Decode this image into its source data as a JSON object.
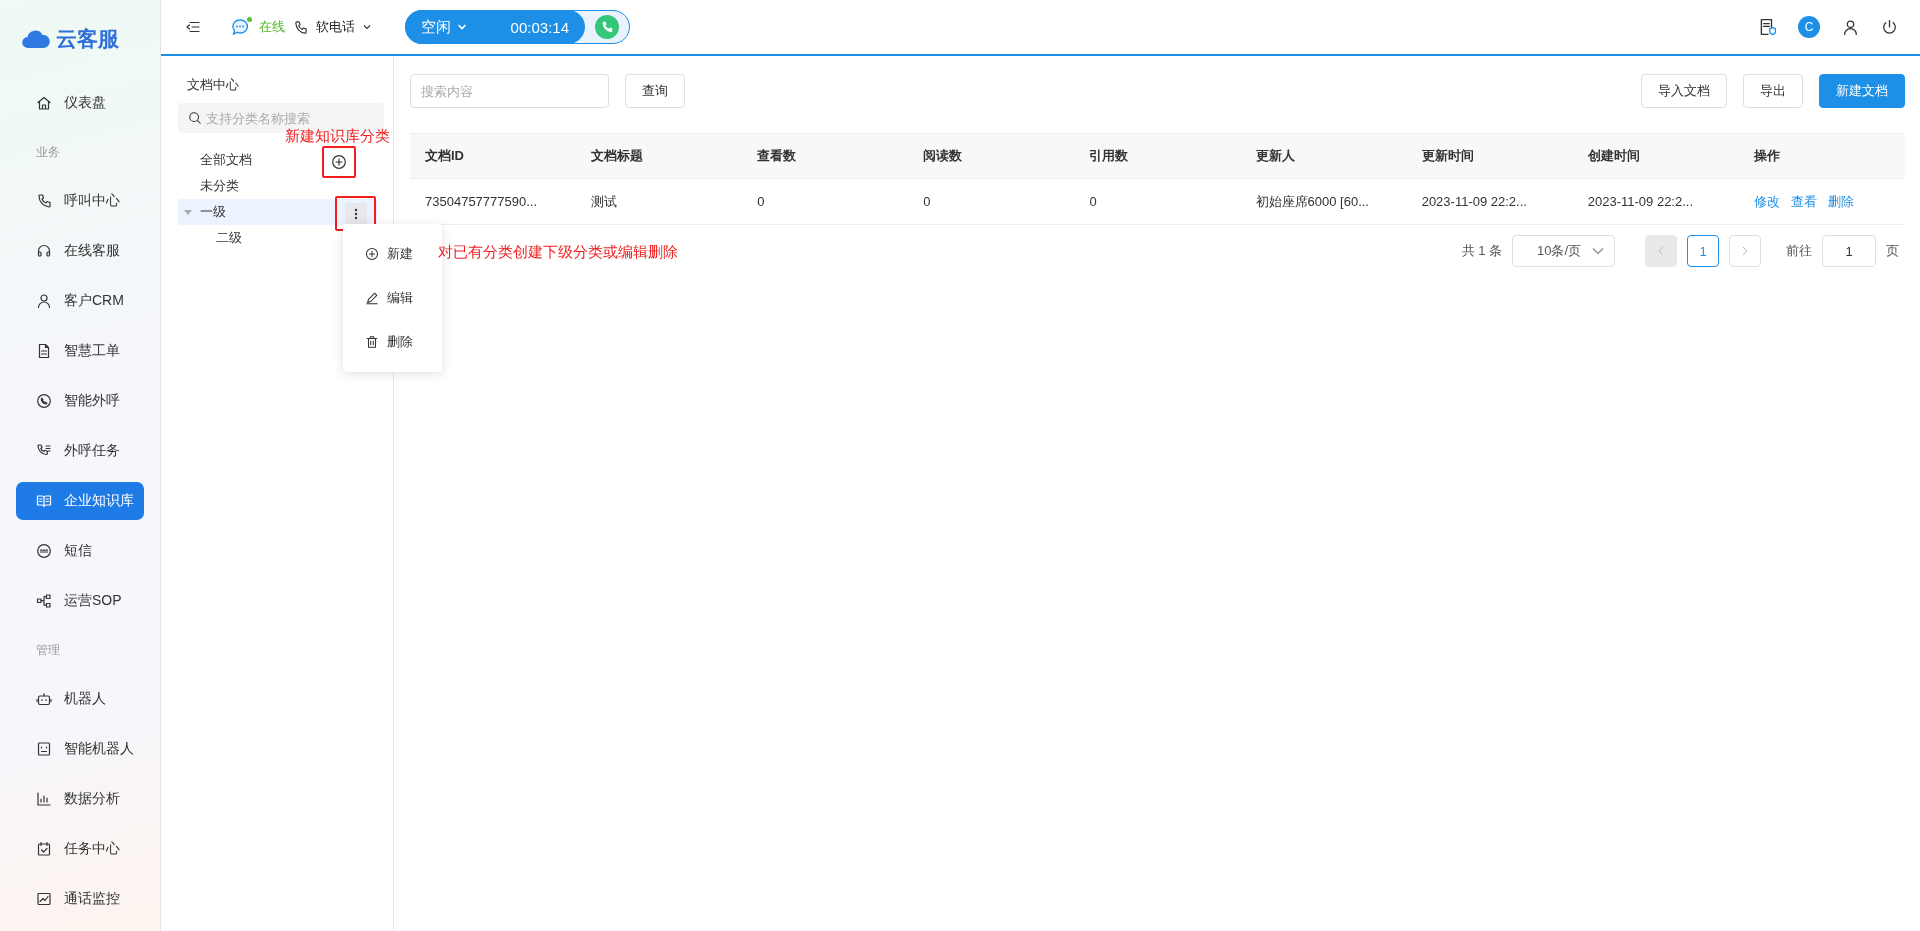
{
  "brand": {
    "name": "云客服"
  },
  "nav": [
    {
      "kind": "item",
      "label": "仪表盘",
      "selected": false
    },
    {
      "kind": "section",
      "label": "业务"
    },
    {
      "kind": "item",
      "label": "呼叫中心",
      "selected": false
    },
    {
      "kind": "item",
      "label": "在线客服",
      "selected": false
    },
    {
      "kind": "item",
      "label": "客户CRM",
      "selected": false
    },
    {
      "kind": "item",
      "label": "智慧工单",
      "selected": false
    },
    {
      "kind": "item",
      "label": "智能外呼",
      "selected": false
    },
    {
      "kind": "item",
      "label": "外呼任务",
      "selected": false
    },
    {
      "kind": "item",
      "label": "企业知识库",
      "selected": true
    },
    {
      "kind": "item",
      "label": "短信",
      "selected": false
    },
    {
      "kind": "item",
      "label": "运营SOP",
      "selected": false
    },
    {
      "kind": "section",
      "label": "管理"
    },
    {
      "kind": "item",
      "label": "机器人",
      "selected": false
    },
    {
      "kind": "item",
      "label": "智能机器人",
      "selected": false
    },
    {
      "kind": "item",
      "label": "数据分析",
      "selected": false
    },
    {
      "kind": "item",
      "label": "任务中心",
      "selected": false
    },
    {
      "kind": "item",
      "label": "通话监控",
      "selected": false
    }
  ],
  "topbar": {
    "status": "在线",
    "phone": "软电话",
    "call_state": "空闲",
    "timer": "00:03:14",
    "avatar": "C"
  },
  "tree": {
    "title": "文档中心",
    "search_placeholder": "支持分类名称搜索",
    "items": [
      {
        "label": "全部文档",
        "selected": false
      },
      {
        "label": "未分类",
        "selected": false
      },
      {
        "label": "一级",
        "selected": true,
        "expanded": true,
        "children": [
          {
            "label": "二级",
            "selected": false
          }
        ]
      }
    ]
  },
  "context_menu": {
    "items": [
      "新建",
      "编辑",
      "删除"
    ]
  },
  "annotations": [
    "新建知识库分类",
    "对已有分类创建下级分类或编辑删除"
  ],
  "toolbar": {
    "search_placeholder": "搜索内容",
    "query_button": "查询",
    "buttons": [
      {
        "label": "导入文档",
        "primary": false
      },
      {
        "label": "导出",
        "primary": false
      },
      {
        "label": "新建文档",
        "primary": true
      }
    ]
  },
  "table": {
    "columns": [
      "文档ID",
      "文档标题",
      "查看数",
      "阅读数",
      "引用数",
      "更新人",
      "更新时间",
      "创建时间",
      "操作"
    ],
    "rows": [
      {
        "cells": [
          "73504757777590...",
          "测试",
          "0",
          "0",
          "0",
          "初始座席6000 [60...",
          "2023-11-09 22:2...",
          "2023-11-09 22:2..."
        ],
        "actions": [
          "修改",
          "查看",
          "删除"
        ]
      }
    ]
  },
  "pagination": {
    "total": "共 1 条",
    "page_size": "10条/页",
    "prev_disabled": true,
    "next_disabled": false,
    "pages": [
      {
        "label": "1",
        "selected": true
      }
    ],
    "goto_label": "前往",
    "goto_value": "1",
    "page_suffix": "页"
  }
}
